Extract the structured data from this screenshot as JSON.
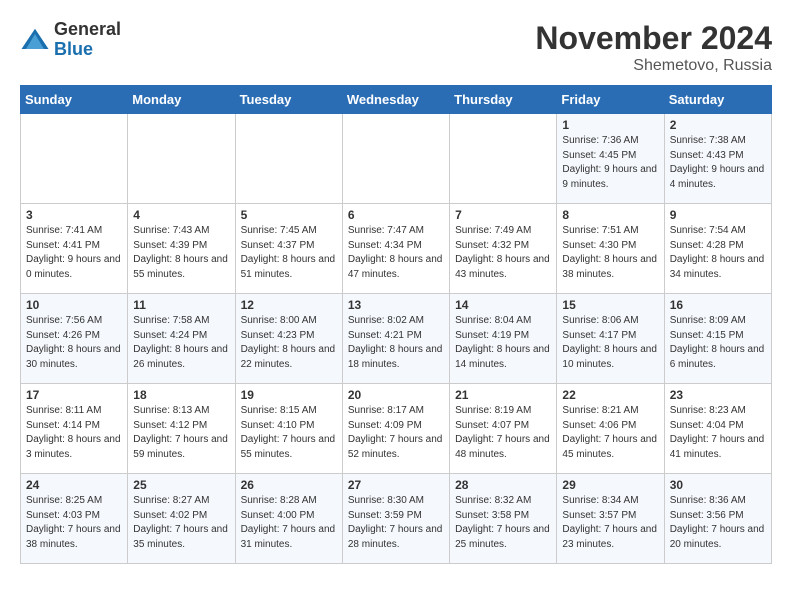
{
  "logo": {
    "general": "General",
    "blue": "Blue"
  },
  "title": {
    "month_year": "November 2024",
    "location": "Shemetovo, Russia"
  },
  "weekdays": [
    "Sunday",
    "Monday",
    "Tuesday",
    "Wednesday",
    "Thursday",
    "Friday",
    "Saturday"
  ],
  "weeks": [
    [
      {
        "day": "",
        "sunrise": "",
        "sunset": "",
        "daylight": ""
      },
      {
        "day": "",
        "sunrise": "",
        "sunset": "",
        "daylight": ""
      },
      {
        "day": "",
        "sunrise": "",
        "sunset": "",
        "daylight": ""
      },
      {
        "day": "",
        "sunrise": "",
        "sunset": "",
        "daylight": ""
      },
      {
        "day": "",
        "sunrise": "",
        "sunset": "",
        "daylight": ""
      },
      {
        "day": "1",
        "sunrise": "Sunrise: 7:36 AM",
        "sunset": "Sunset: 4:45 PM",
        "daylight": "Daylight: 9 hours and 9 minutes."
      },
      {
        "day": "2",
        "sunrise": "Sunrise: 7:38 AM",
        "sunset": "Sunset: 4:43 PM",
        "daylight": "Daylight: 9 hours and 4 minutes."
      }
    ],
    [
      {
        "day": "3",
        "sunrise": "Sunrise: 7:41 AM",
        "sunset": "Sunset: 4:41 PM",
        "daylight": "Daylight: 9 hours and 0 minutes."
      },
      {
        "day": "4",
        "sunrise": "Sunrise: 7:43 AM",
        "sunset": "Sunset: 4:39 PM",
        "daylight": "Daylight: 8 hours and 55 minutes."
      },
      {
        "day": "5",
        "sunrise": "Sunrise: 7:45 AM",
        "sunset": "Sunset: 4:37 PM",
        "daylight": "Daylight: 8 hours and 51 minutes."
      },
      {
        "day": "6",
        "sunrise": "Sunrise: 7:47 AM",
        "sunset": "Sunset: 4:34 PM",
        "daylight": "Daylight: 8 hours and 47 minutes."
      },
      {
        "day": "7",
        "sunrise": "Sunrise: 7:49 AM",
        "sunset": "Sunset: 4:32 PM",
        "daylight": "Daylight: 8 hours and 43 minutes."
      },
      {
        "day": "8",
        "sunrise": "Sunrise: 7:51 AM",
        "sunset": "Sunset: 4:30 PM",
        "daylight": "Daylight: 8 hours and 38 minutes."
      },
      {
        "day": "9",
        "sunrise": "Sunrise: 7:54 AM",
        "sunset": "Sunset: 4:28 PM",
        "daylight": "Daylight: 8 hours and 34 minutes."
      }
    ],
    [
      {
        "day": "10",
        "sunrise": "Sunrise: 7:56 AM",
        "sunset": "Sunset: 4:26 PM",
        "daylight": "Daylight: 8 hours and 30 minutes."
      },
      {
        "day": "11",
        "sunrise": "Sunrise: 7:58 AM",
        "sunset": "Sunset: 4:24 PM",
        "daylight": "Daylight: 8 hours and 26 minutes."
      },
      {
        "day": "12",
        "sunrise": "Sunrise: 8:00 AM",
        "sunset": "Sunset: 4:23 PM",
        "daylight": "Daylight: 8 hours and 22 minutes."
      },
      {
        "day": "13",
        "sunrise": "Sunrise: 8:02 AM",
        "sunset": "Sunset: 4:21 PM",
        "daylight": "Daylight: 8 hours and 18 minutes."
      },
      {
        "day": "14",
        "sunrise": "Sunrise: 8:04 AM",
        "sunset": "Sunset: 4:19 PM",
        "daylight": "Daylight: 8 hours and 14 minutes."
      },
      {
        "day": "15",
        "sunrise": "Sunrise: 8:06 AM",
        "sunset": "Sunset: 4:17 PM",
        "daylight": "Daylight: 8 hours and 10 minutes."
      },
      {
        "day": "16",
        "sunrise": "Sunrise: 8:09 AM",
        "sunset": "Sunset: 4:15 PM",
        "daylight": "Daylight: 8 hours and 6 minutes."
      }
    ],
    [
      {
        "day": "17",
        "sunrise": "Sunrise: 8:11 AM",
        "sunset": "Sunset: 4:14 PM",
        "daylight": "Daylight: 8 hours and 3 minutes."
      },
      {
        "day": "18",
        "sunrise": "Sunrise: 8:13 AM",
        "sunset": "Sunset: 4:12 PM",
        "daylight": "Daylight: 7 hours and 59 minutes."
      },
      {
        "day": "19",
        "sunrise": "Sunrise: 8:15 AM",
        "sunset": "Sunset: 4:10 PM",
        "daylight": "Daylight: 7 hours and 55 minutes."
      },
      {
        "day": "20",
        "sunrise": "Sunrise: 8:17 AM",
        "sunset": "Sunset: 4:09 PM",
        "daylight": "Daylight: 7 hours and 52 minutes."
      },
      {
        "day": "21",
        "sunrise": "Sunrise: 8:19 AM",
        "sunset": "Sunset: 4:07 PM",
        "daylight": "Daylight: 7 hours and 48 minutes."
      },
      {
        "day": "22",
        "sunrise": "Sunrise: 8:21 AM",
        "sunset": "Sunset: 4:06 PM",
        "daylight": "Daylight: 7 hours and 45 minutes."
      },
      {
        "day": "23",
        "sunrise": "Sunrise: 8:23 AM",
        "sunset": "Sunset: 4:04 PM",
        "daylight": "Daylight: 7 hours and 41 minutes."
      }
    ],
    [
      {
        "day": "24",
        "sunrise": "Sunrise: 8:25 AM",
        "sunset": "Sunset: 4:03 PM",
        "daylight": "Daylight: 7 hours and 38 minutes."
      },
      {
        "day": "25",
        "sunrise": "Sunrise: 8:27 AM",
        "sunset": "Sunset: 4:02 PM",
        "daylight": "Daylight: 7 hours and 35 minutes."
      },
      {
        "day": "26",
        "sunrise": "Sunrise: 8:28 AM",
        "sunset": "Sunset: 4:00 PM",
        "daylight": "Daylight: 7 hours and 31 minutes."
      },
      {
        "day": "27",
        "sunrise": "Sunrise: 8:30 AM",
        "sunset": "Sunset: 3:59 PM",
        "daylight": "Daylight: 7 hours and 28 minutes."
      },
      {
        "day": "28",
        "sunrise": "Sunrise: 8:32 AM",
        "sunset": "Sunset: 3:58 PM",
        "daylight": "Daylight: 7 hours and 25 minutes."
      },
      {
        "day": "29",
        "sunrise": "Sunrise: 8:34 AM",
        "sunset": "Sunset: 3:57 PM",
        "daylight": "Daylight: 7 hours and 23 minutes."
      },
      {
        "day": "30",
        "sunrise": "Sunrise: 8:36 AM",
        "sunset": "Sunset: 3:56 PM",
        "daylight": "Daylight: 7 hours and 20 minutes."
      }
    ]
  ]
}
